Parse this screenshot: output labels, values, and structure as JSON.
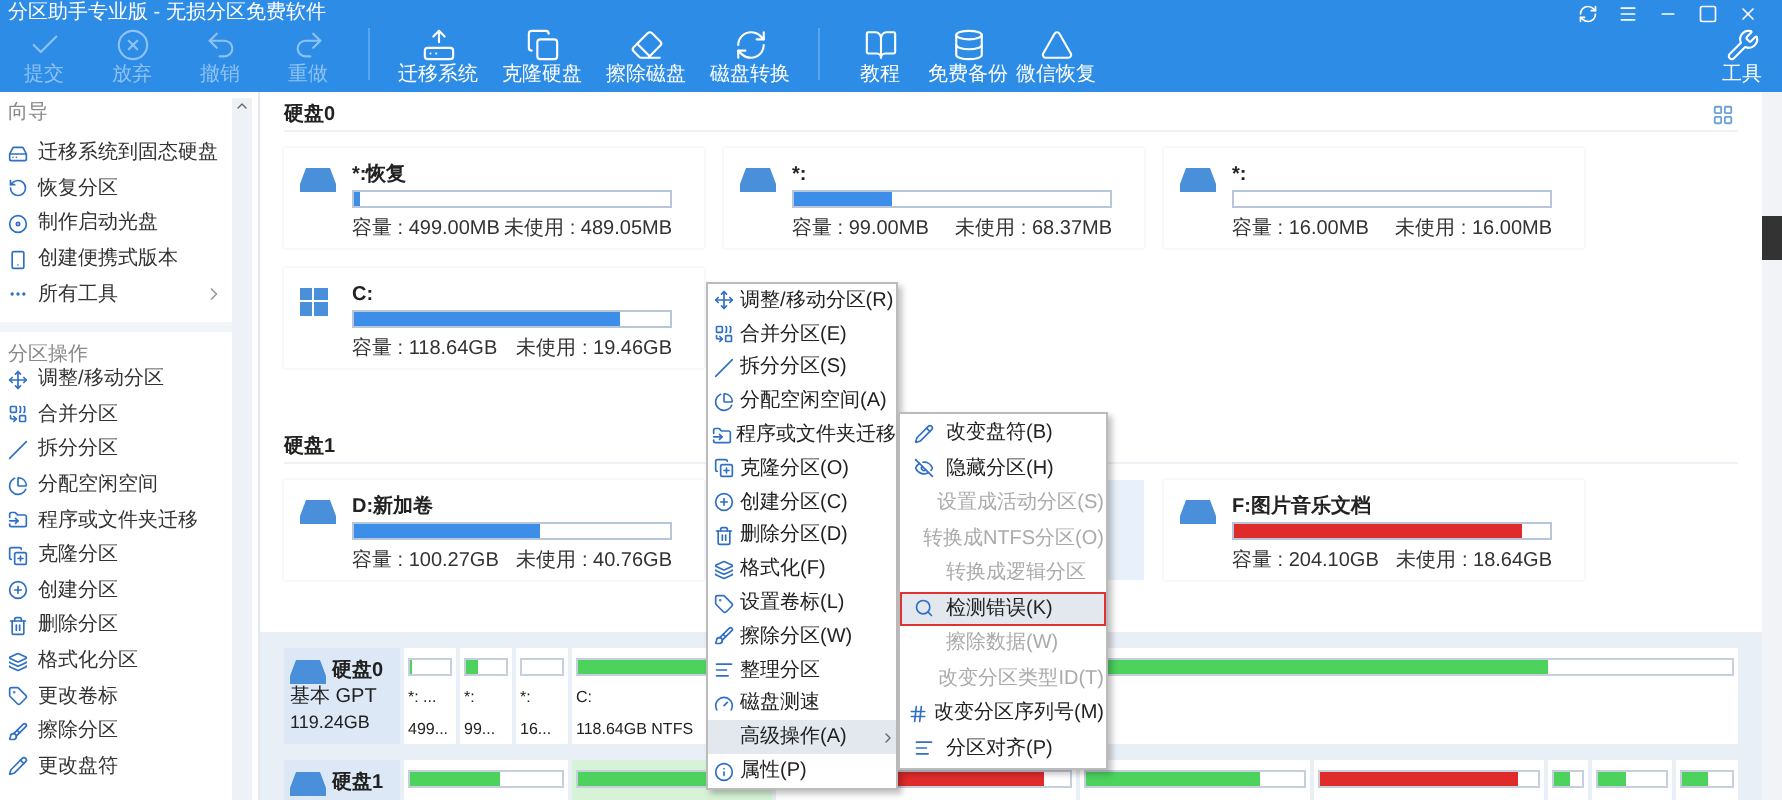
{
  "window": {
    "title": "分区助手专业版 - 无损分区免费软件"
  },
  "toolbar": [
    [
      {
        "label": "提交",
        "disabled": true
      },
      {
        "label": "放弃",
        "disabled": true
      },
      {
        "label": "撤销",
        "disabled": true
      },
      {
        "label": "重做",
        "disabled": true
      }
    ],
    [
      {
        "label": "迁移系统",
        "disabled": false
      },
      {
        "label": "克隆硬盘",
        "disabled": false
      },
      {
        "label": "擦除磁盘",
        "disabled": false
      },
      {
        "label": "磁盘转换",
        "disabled": false
      }
    ],
    [
      {
        "label": "教程",
        "disabled": false
      },
      {
        "label": "免费备份",
        "disabled": false
      },
      {
        "label": "微信恢复",
        "disabled": false
      }
    ]
  ],
  "tools_button": {
    "label": "工具"
  },
  "sidebar": [
    {
      "title": "向导",
      "items": [
        {
          "label": "迁移系统到固态硬盘",
          "arrow": false
        },
        {
          "label": "恢复分区",
          "arrow": false
        },
        {
          "label": "制作启动光盘",
          "arrow": false
        },
        {
          "label": "创建便携式版本",
          "arrow": false
        },
        {
          "label": "所有工具",
          "arrow": true
        }
      ]
    },
    {
      "title": "分区操作",
      "items": [
        {
          "label": "调整/移动分区",
          "arrow": false
        },
        {
          "label": "合并分区",
          "arrow": false
        },
        {
          "label": "拆分分区",
          "arrow": false
        },
        {
          "label": "分配空闲空间",
          "arrow": false
        },
        {
          "label": "程序或文件夹迁移",
          "arrow": false
        },
        {
          "label": "克隆分区",
          "arrow": false
        },
        {
          "label": "创建分区",
          "arrow": false
        },
        {
          "label": "删除分区",
          "arrow": false
        },
        {
          "label": "格式化分区",
          "arrow": false
        },
        {
          "label": "更改卷标",
          "arrow": false
        },
        {
          "label": "擦除分区",
          "arrow": false
        },
        {
          "label": "更改盘符",
          "arrow": false
        }
      ]
    }
  ],
  "disks": [
    {
      "label": "硬盘0",
      "cards": [
        {
          "kind": "partition",
          "name": "*:恢复",
          "level": 0.02,
          "color": "#3d8ee8",
          "capacity": "容量 : 499.00MB",
          "unused": "未使用 : 489.05MB",
          "selected": false
        },
        {
          "kind": "partition",
          "name": "*:",
          "level": 0.31,
          "color": "#3d8ee8",
          "capacity": "容量 : 99.00MB",
          "unused": "未使用 : 68.37MB",
          "selected": false
        },
        {
          "kind": "partition",
          "name": "*:",
          "capacity": "容量 : 16.00MB",
          "unused": "未使用 : 16.00MB",
          "selected": false
        },
        {
          "kind": "system",
          "name": "C:",
          "level": 0.84,
          "color": "#3d8ee8",
          "capacity": "容量 : 118.64GB",
          "unused": "未使用 : 19.46GB",
          "selected": false
        }
      ]
    },
    {
      "label": "硬盘1",
      "cards": [
        {
          "kind": "partition",
          "name": "D:新加卷",
          "level": 0.59,
          "color": "#3d8ee8",
          "capacity": "容量 : 100.27GB",
          "unused": "未使用 : 40.76GB",
          "selected": false
        },
        {
          "kind": "covered",
          "selected": true
        },
        {
          "kind": "partition",
          "name": "F:图片音乐文档",
          "level": 0.91,
          "color": "#e02b2b",
          "capacity": "容量 : 204.10GB",
          "unused": "未使用 : 18.64GB",
          "selected": false
        }
      ]
    }
  ],
  "disk_map": [
    {
      "name": "硬盘0",
      "type": "基本 GPT",
      "size": "119.24GB",
      "partitions": [
        {
          "name": "*: ...",
          "size": "499...",
          "level": 0.02,
          "color": "#4cd25d",
          "selected": false
        },
        {
          "name": "*:",
          "size": "99...",
          "level": 0.31,
          "color": "#4cd25d",
          "selected": false
        },
        {
          "name": "*:",
          "size": "16...",
          "selected": false
        },
        {
          "name": "C:",
          "size": "118.64GB NTFS",
          "level": 0.84,
          "color": "#4cd25d",
          "selected": false
        }
      ]
    },
    {
      "name": "硬盘1",
      "partitions": [
        {
          "level": 0.59,
          "color": "#4cd25d",
          "selected": false
        },
        {
          "level": 0.9,
          "color": "#4cd25d",
          "selected": true
        },
        {
          "level": 0.91,
          "color": "#e02b2b",
          "selected": false
        },
        {
          "level": 0.8,
          "color": "#4cd25d",
          "selected": false
        },
        {
          "level": 0.91,
          "color": "#e02b2b",
          "selected": false
        },
        {
          "level": 0.6,
          "color": "#4cd25d",
          "selected": false
        },
        {
          "level": 0.4,
          "color": "#4cd25d",
          "selected": false
        },
        {
          "level": 0.5,
          "color": "#4cd25d",
          "selected": false
        }
      ]
    }
  ],
  "context_menu": [
    {
      "label": "调整/移动分区(R)",
      "selected": false,
      "submenu": false
    },
    {
      "label": "合并分区(E)",
      "selected": false,
      "submenu": false
    },
    {
      "label": "拆分分区(S)",
      "selected": false,
      "submenu": false
    },
    {
      "label": "分配空闲空间(A)",
      "selected": false,
      "submenu": false
    },
    {
      "label": "程序或文件夹迁移",
      "selected": false,
      "submenu": false
    },
    {
      "label": "克隆分区(O)",
      "selected": false,
      "submenu": false
    },
    {
      "label": "创建分区(C)",
      "selected": false,
      "submenu": false
    },
    {
      "label": "删除分区(D)",
      "selected": false,
      "submenu": false
    },
    {
      "label": "格式化(F)",
      "selected": false,
      "submenu": false
    },
    {
      "label": "设置卷标(L)",
      "selected": false,
      "submenu": false
    },
    {
      "label": "擦除分区(W)",
      "selected": false,
      "submenu": false
    },
    {
      "label": "整理分区",
      "selected": false,
      "submenu": false
    },
    {
      "label": "磁盘测速",
      "selected": false,
      "submenu": false
    },
    {
      "label": "高级操作(A)",
      "selected": true,
      "submenu": true
    },
    {
      "label": "属性(P)",
      "selected": false,
      "submenu": false
    }
  ],
  "submenu": [
    {
      "label": "改变盘符(B)",
      "disabled": false,
      "selected": false
    },
    {
      "label": "隐藏分区(H)",
      "disabled": false,
      "selected": false
    },
    {
      "label": "设置成活动分区(S)",
      "disabled": true,
      "selected": false
    },
    {
      "label": "转换成NTFS分区(O)",
      "disabled": true,
      "selected": false
    },
    {
      "label": "转换成逻辑分区",
      "disabled": true,
      "selected": false
    },
    {
      "label": "检测错误(K)",
      "disabled": false,
      "selected": true
    },
    {
      "label": "擦除数据(W)",
      "disabled": true,
      "selected": false
    },
    {
      "label": "改变分区类型ID(T)",
      "disabled": true,
      "selected": false
    },
    {
      "label": "改变分区序列号(M)",
      "disabled": false,
      "selected": false
    },
    {
      "label": "分区对齐(P)",
      "disabled": false,
      "selected": false
    }
  ]
}
